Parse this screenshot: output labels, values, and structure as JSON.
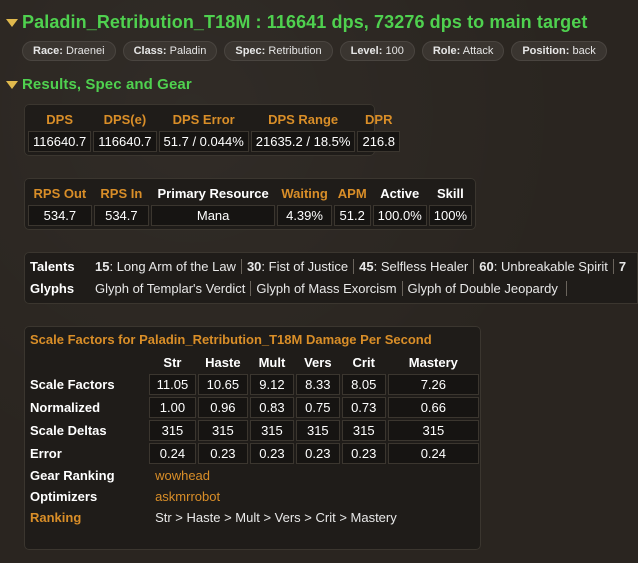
{
  "header": {
    "title": "Paladin_Retribution_T18M : 116641 dps, 73276 dps to main target",
    "pills": [
      {
        "key": "Race:",
        "value": "Draenei"
      },
      {
        "key": "Class:",
        "value": "Paladin"
      },
      {
        "key": "Spec:",
        "value": "Retribution"
      },
      {
        "key": "Level:",
        "value": "100"
      },
      {
        "key": "Role:",
        "value": "Attack"
      },
      {
        "key": "Position:",
        "value": "back"
      }
    ]
  },
  "section": {
    "title": "Results, Spec and Gear"
  },
  "dps_table": {
    "headers": [
      "DPS",
      "DPS(e)",
      "DPS Error",
      "DPS Range",
      "DPR"
    ],
    "values": [
      "116640.7",
      "116640.7",
      "51.7 / 0.044%",
      "21635.2 / 18.5%",
      "216.8"
    ]
  },
  "rps_table": {
    "headers": [
      "RPS Out",
      "RPS In",
      "Primary Resource",
      "Waiting",
      "APM",
      "Active",
      "Skill"
    ],
    "values": [
      "534.7",
      "534.7",
      "Mana",
      "4.39%",
      "51.2",
      "100.0%",
      "100%"
    ]
  },
  "talents": {
    "label": "Talents",
    "items": [
      {
        "level": "15",
        "name": "Long Arm of the Law"
      },
      {
        "level": "30",
        "name": "Fist of Justice"
      },
      {
        "level": "45",
        "name": "Selfless Healer"
      },
      {
        "level": "60",
        "name": "Unbreakable Spirit"
      },
      {
        "level": "7",
        "name": ""
      }
    ]
  },
  "glyphs": {
    "label": "Glyphs",
    "items": [
      "Glyph of Templar's Verdict",
      "Glyph of Mass Exorcism",
      "Glyph of Double Jeopardy",
      ""
    ]
  },
  "scale": {
    "title": "Scale Factors for Paladin_Retribution_T18M Damage Per Second",
    "columns": [
      "Str",
      "Haste",
      "Mult",
      "Vers",
      "Crit",
      "Mastery"
    ],
    "rows": [
      {
        "label": "Scale Factors",
        "values": [
          "11.05",
          "10.65",
          "9.12",
          "8.33",
          "8.05",
          "7.26"
        ]
      },
      {
        "label": "Normalized",
        "values": [
          "1.00",
          "0.96",
          "0.83",
          "0.75",
          "0.73",
          "0.66"
        ]
      },
      {
        "label": "Scale Deltas",
        "values": [
          "315",
          "315",
          "315",
          "315",
          "315",
          "315"
        ]
      },
      {
        "label": "Error",
        "values": [
          "0.24",
          "0.23",
          "0.23",
          "0.23",
          "0.23",
          "0.24"
        ]
      }
    ],
    "gear_ranking": {
      "label": "Gear Ranking",
      "link": "wowhead"
    },
    "optimizers": {
      "label": "Optimizers",
      "link": "askmrrobot"
    },
    "ranking": {
      "label": "Ranking",
      "text": "Str > Haste > Mult > Vers > Crit > Mastery"
    }
  },
  "colors": {
    "title_green": "#4fd14f",
    "header_orange": "#d98e28",
    "background": "#2a2520"
  }
}
